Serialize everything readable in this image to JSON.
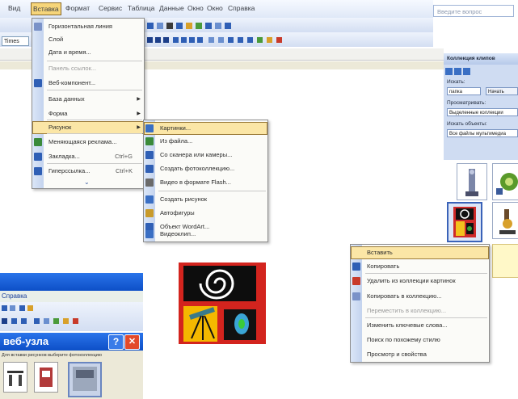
{
  "menubar": {
    "items": [
      "Вид",
      "Вставка",
      "Формат",
      "Сервис",
      "Таблица",
      "Данные",
      "Окно",
      "Окно",
      "Справка"
    ],
    "search_placeholder": "Введите вопрос"
  },
  "toolbar": {
    "font_name": "Times"
  },
  "insert_menu": {
    "items": [
      {
        "label": "Горизонтальная линия",
        "shortcut": "",
        "submenu": false,
        "disabled": false,
        "highlight": false
      },
      {
        "label": "Слой",
        "shortcut": "",
        "submenu": false,
        "disabled": false,
        "highlight": false
      },
      {
        "label": "Дата и время...",
        "shortcut": "",
        "submenu": false,
        "disabled": false,
        "highlight": false
      },
      {
        "label": "Панель ссылок...",
        "shortcut": "",
        "submenu": false,
        "disabled": true,
        "highlight": false
      },
      {
        "label": "Веб-компонент...",
        "shortcut": "",
        "submenu": false,
        "disabled": false,
        "highlight": false
      },
      {
        "label": "База данных",
        "shortcut": "",
        "submenu": true,
        "disabled": false,
        "highlight": false
      },
      {
        "label": "Форма",
        "shortcut": "",
        "submenu": true,
        "disabled": false,
        "highlight": false
      },
      {
        "label": "Рисунок",
        "shortcut": "",
        "submenu": true,
        "disabled": false,
        "highlight": true
      },
      {
        "label": "Меняющаяся реклама...",
        "shortcut": "",
        "submenu": false,
        "disabled": false,
        "highlight": false
      },
      {
        "label": "Закладка...",
        "shortcut": "Ctrl+G",
        "submenu": false,
        "disabled": false,
        "highlight": false
      },
      {
        "label": "Гиперссылка...",
        "shortcut": "Ctrl+K",
        "submenu": false,
        "disabled": false,
        "highlight": false
      }
    ]
  },
  "picture_submenu": {
    "items": [
      {
        "label": "Картинки...",
        "highlight": true
      },
      {
        "label": "Из файла...",
        "highlight": false
      },
      {
        "label": "Со сканера или камеры...",
        "highlight": false
      },
      {
        "label": "Создать фотоколлекцию...",
        "highlight": false
      },
      {
        "label": "Видео в формате Flash...",
        "highlight": false
      },
      {
        "label": "Создать рисунок",
        "highlight": false
      },
      {
        "label": "Автофигуры",
        "highlight": false
      },
      {
        "label": "Объект WordArt...",
        "highlight": false
      },
      {
        "label": "Видеоклип...",
        "highlight": false
      }
    ]
  },
  "task_pane": {
    "title": "Коллекция клипов",
    "search_label": "Искать:",
    "search_value": "папка",
    "search_button": "Начать",
    "scope_label": "Просматривать:",
    "scope_value": "Выделенные коллекции",
    "types_label": "Искать объекты:",
    "types_value": "Все файлы мультимедиа"
  },
  "context_menu": {
    "items": [
      {
        "label": "Вставить",
        "highlight": true,
        "disabled": false
      },
      {
        "label": "Копировать",
        "highlight": false,
        "disabled": false
      },
      {
        "label": "Удалить из коллекции картинок",
        "highlight": false,
        "disabled": false
      },
      {
        "label": "Копировать в коллекцию...",
        "highlight": false,
        "disabled": false
      },
      {
        "label": "Переместить в коллекцию...",
        "highlight": false,
        "disabled": true
      },
      {
        "label": "Изменить ключевые слова...",
        "highlight": false,
        "disabled": false
      },
      {
        "label": "Поиск по похожему стилю",
        "highlight": false,
        "disabled": false
      },
      {
        "label": "Просмотр и свойства",
        "highlight": false,
        "disabled": false
      }
    ]
  },
  "inset_window": {
    "menu_label": "Справка",
    "dialog_title": "веб-узла",
    "help_button": "?",
    "close_button": "✕",
    "dialog_hint": "Для вставки рисунков выберите фотоколлекцию"
  },
  "colors": {
    "menu_highlight": "#fbe6a6",
    "titlebar": "#1c5cd9",
    "close_red": "#e34a2a"
  }
}
